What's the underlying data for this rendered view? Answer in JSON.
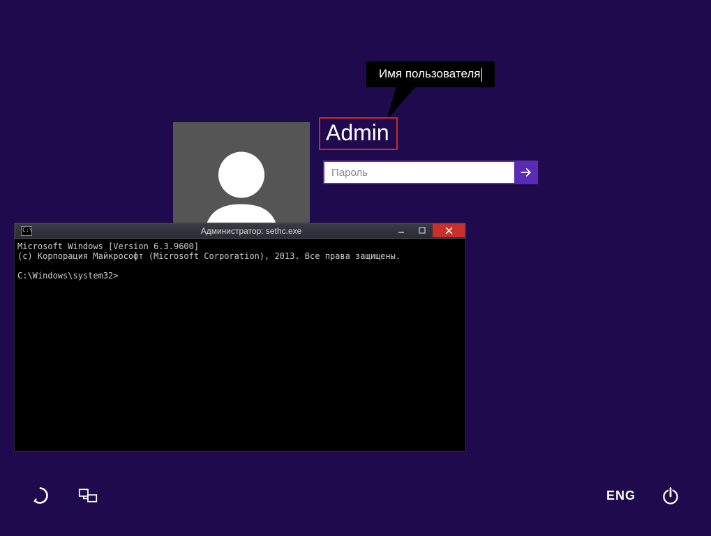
{
  "tooltip": {
    "label": "Имя пользователя"
  },
  "login": {
    "username": "Admin",
    "password_placeholder": "Пароль"
  },
  "cmd": {
    "title": "Администратор: sethc.exe",
    "icon_label": "C:\\",
    "lines": [
      "Microsoft Windows [Version 6.3.9600]",
      "(c) Корпорация Майкрософт (Microsoft Corporation), 2013. Все права защищены.",
      "",
      "C:\\Windows\\system32>"
    ]
  },
  "bottom": {
    "language": "ENG"
  }
}
